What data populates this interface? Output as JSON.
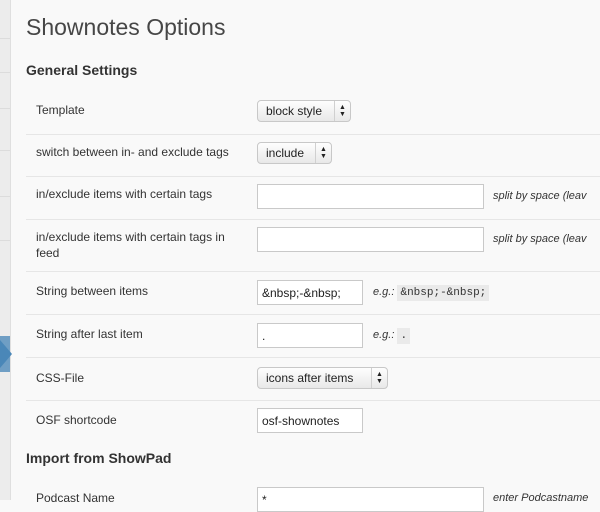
{
  "page": {
    "title": "Shownotes Options"
  },
  "general": {
    "title": "General Settings",
    "template": {
      "label": "Template",
      "value": "block style"
    },
    "switch_tags": {
      "label": "switch between in- and exclude tags",
      "value": "include"
    },
    "tags_items": {
      "label": "in/exclude items with certain tags",
      "value": "",
      "hint": "split by space  (leav"
    },
    "tags_feed": {
      "label_line1": "in/exclude items with certain tags in",
      "label_line2": "feed",
      "value": "",
      "hint": "split by space  (leav"
    },
    "string_between": {
      "label": "String between items",
      "value": "&nbsp;-&nbsp;",
      "hint_prefix": "e.g.:",
      "hint_code": "&nbsp;-&nbsp;"
    },
    "string_after": {
      "label": "String after last item",
      "value": ".",
      "hint_prefix": "e.g.:",
      "hint_code": "."
    },
    "css_file": {
      "label": "CSS-File",
      "value": "icons after items"
    },
    "osf_shortcode": {
      "label": "OSF shortcode",
      "value": "osf-shownotes"
    }
  },
  "import": {
    "title": "Import from ShowPad",
    "podcast_name": {
      "label": "Podcast Name",
      "value": "*",
      "hint": "enter Podcastname"
    }
  },
  "colors": {
    "sidebar_arrow": "#4a87b8",
    "title": "#464646"
  }
}
